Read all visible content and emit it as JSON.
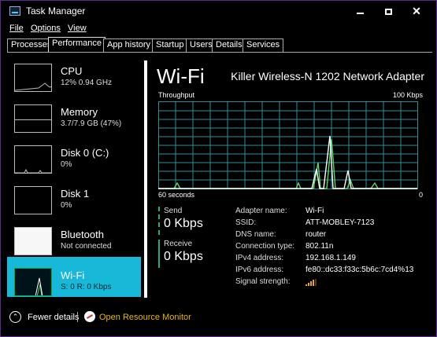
{
  "window": {
    "title": "Task Manager"
  },
  "menu": {
    "file": "File",
    "options": "Options",
    "view": "View"
  },
  "tabs": [
    "Processes",
    "Performance",
    "App history",
    "Startup",
    "Users",
    "Details",
    "Services"
  ],
  "active_tab": "Performance",
  "resources": [
    {
      "name": "CPU",
      "sub": "12% 0.94 GHz"
    },
    {
      "name": "Memory",
      "sub": "3.7/7.9 GB (47%)"
    },
    {
      "name": "Disk 0 (C:)",
      "sub": "0%"
    },
    {
      "name": "Disk 1",
      "sub": "0%"
    },
    {
      "name": "Bluetooth",
      "sub": "Not connected"
    },
    {
      "name": "Wi-Fi",
      "sub": "S: 0 R: 0 Kbps"
    }
  ],
  "selected_resource": "Wi-Fi",
  "detail": {
    "title": "Wi-Fi",
    "adapter": "Killer Wireless-N 1202 Network Adapter",
    "chart_label": "Throughput",
    "chart_max": "100 Kbps",
    "chart_time": "60 seconds",
    "chart_min": "0",
    "send_label": "Send",
    "send_value": "0 Kbps",
    "receive_label": "Receive",
    "receive_value": "0 Kbps",
    "properties": [
      {
        "key": "Adapter name:",
        "value": "Wi-Fi"
      },
      {
        "key": "SSID:",
        "value": "ATT-MOBLEY-7123"
      },
      {
        "key": "DNS name:",
        "value": "router"
      },
      {
        "key": "Connection type:",
        "value": "802.11n"
      },
      {
        "key": "IPv4 address:",
        "value": "192.168.1.149"
      },
      {
        "key": "IPv6 address:",
        "value": "fe80::dc33:f33c:5b6c:7cd4%13"
      },
      {
        "key": "Signal strength:",
        "value": ""
      }
    ],
    "signal_bars": 4
  },
  "footer": {
    "fewer_details": "Fewer details",
    "open_resource_monitor": "Open Resource Monitor"
  },
  "colors": {
    "accent_selected": "#17b8d8",
    "graph_grid": "#2f8f96",
    "send_line": "#5fd36a",
    "receive_line": "#ffffff",
    "link": "#e6b800"
  },
  "icons": {
    "app": "task-manager-icon",
    "fewer": "chevron-up-circle-icon",
    "resource_monitor": "resource-monitor-icon",
    "signal": "signal-strength-icon"
  }
}
